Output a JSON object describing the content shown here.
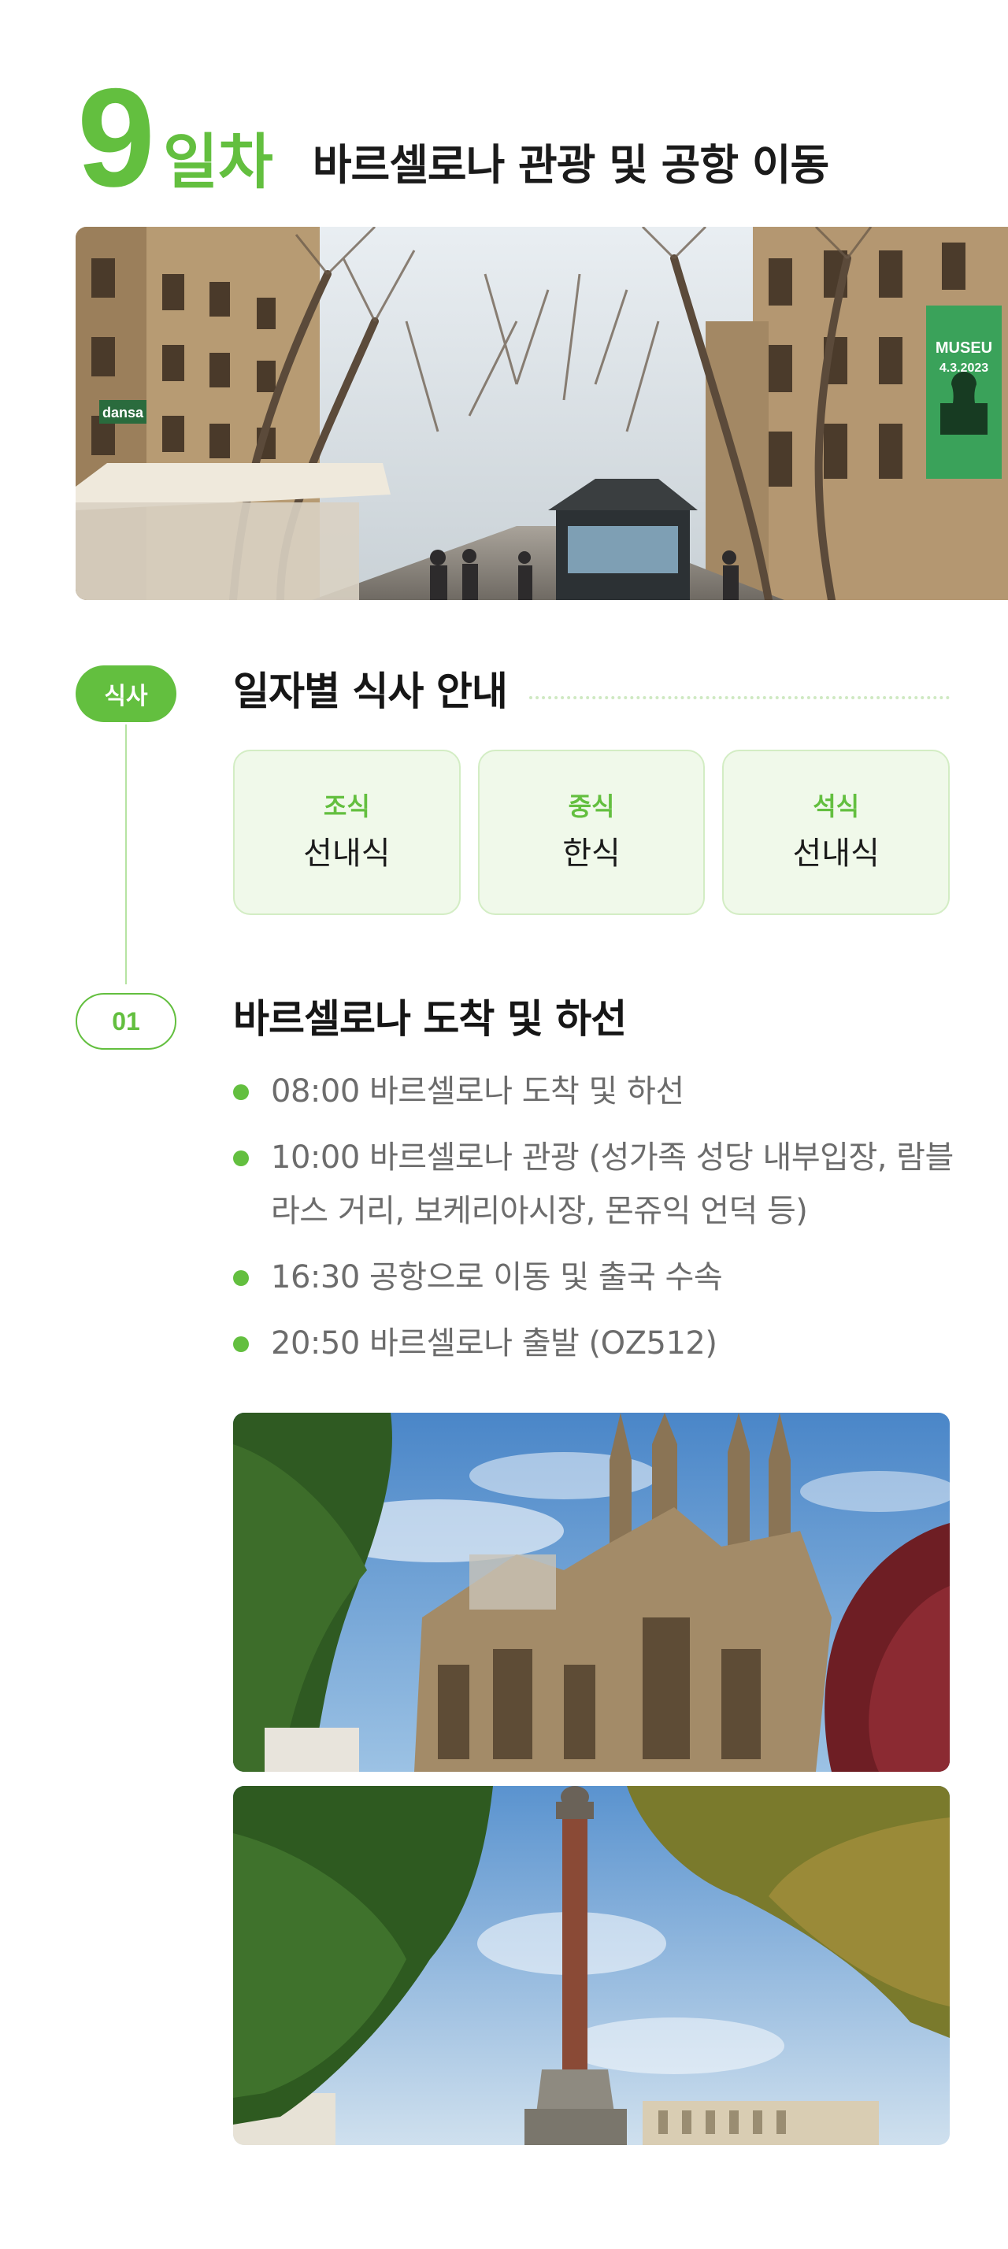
{
  "day": {
    "number": "9",
    "unit": "일차",
    "title": "바르셀로나 관광 및 공항 이동"
  },
  "meal_section": {
    "badge": "식사",
    "title": "일자별 식사 안내",
    "meals": [
      {
        "label": "조식",
        "value": "선내식"
      },
      {
        "label": "중식",
        "value": "한식"
      },
      {
        "label": "석식",
        "value": "선내식"
      }
    ]
  },
  "itinerary": {
    "badge": "01",
    "title": "바르셀로나 도착 및 하선",
    "items": [
      "08:00 바르셀로나 도착 및 하선",
      "10:00 바르셀로나 관광 (성가족 성당 내부입장, 람블라스 거리, 보케리아시장, 몬쥬익 언덕 등)",
      "16:30 공항으로 이동 및 출국 수속",
      "20:50 바르셀로나 출발 (OZ512)"
    ]
  },
  "photos": {
    "hero_sign_text": "dansa",
    "hero_banner_text": "MUSEU",
    "hero_banner_date": "4.3.2023"
  },
  "colors": {
    "accent": "#63bf3f",
    "card_bg": "#f0f9ea",
    "body_text": "#6c6c6c"
  }
}
